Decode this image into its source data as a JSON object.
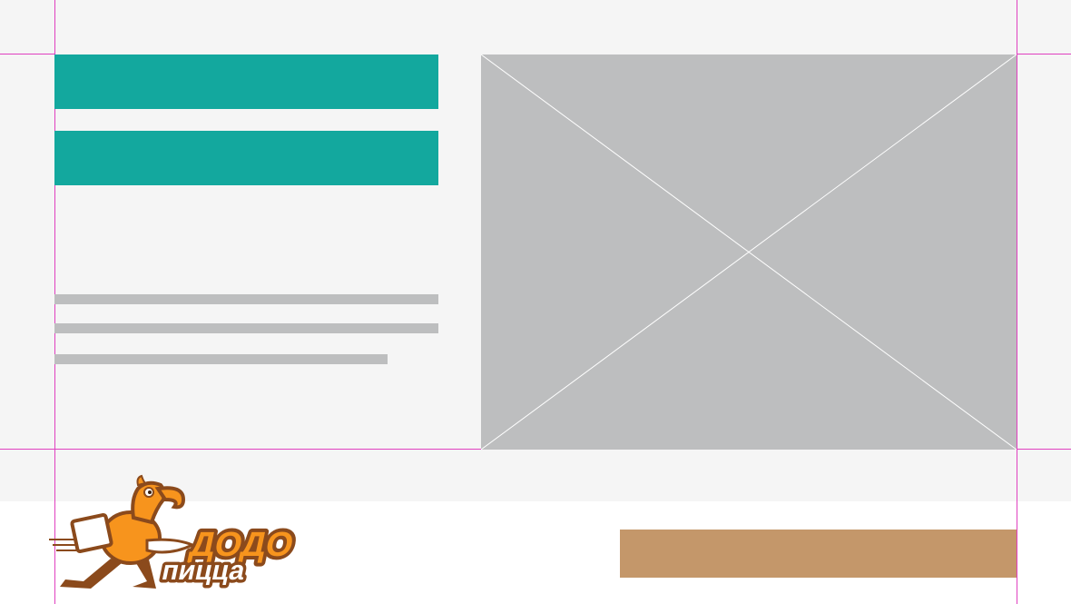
{
  "logo": {
    "brand_word_1": "ДОДО",
    "brand_word_2": "пицца",
    "icon": "dodo-bird-courier-icon"
  },
  "colors": {
    "background": "#f5f5f5",
    "footer_background": "#ffffff",
    "guide": "#e040c0",
    "teal_accent": "#13a89e",
    "placeholder_gray": "#bdbebf",
    "button_brown": "#c4976a",
    "logo_orange": "#f7941d",
    "logo_brown": "#8b4a1c"
  }
}
